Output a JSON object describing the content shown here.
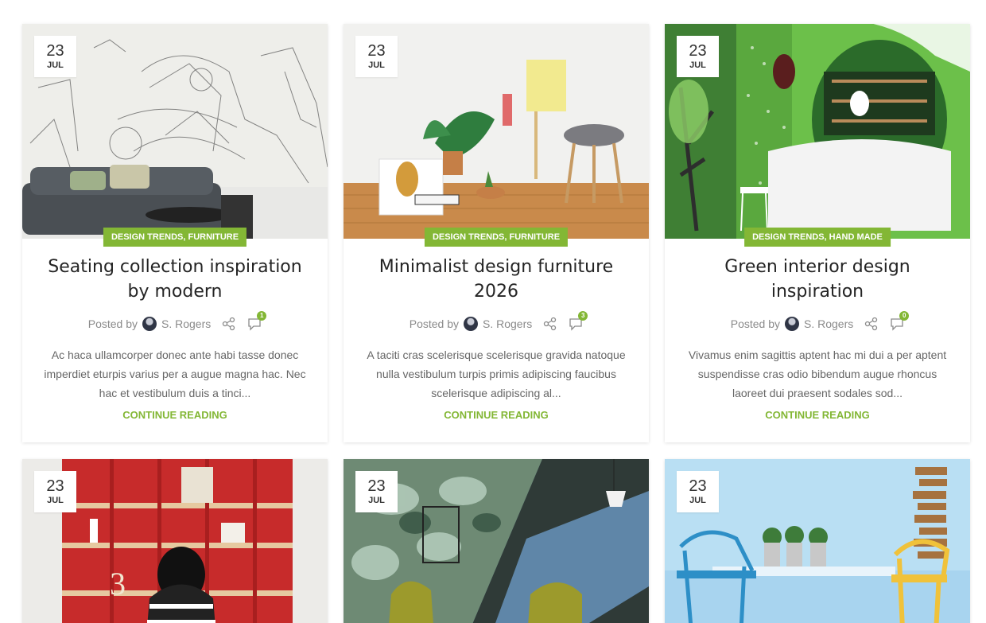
{
  "posts": [
    {
      "day": "23",
      "month": "JUL",
      "categories": "DESIGN TRENDS, FURNITURE",
      "title": "Seating collection inspiration by modern",
      "posted_by_label": "Posted by",
      "author": "S. Rogers",
      "comments": "1",
      "excerpt": "Ac haca ullamcorper donec ante habi tasse donec imperdiet eturpis varius per a augue magna hac. Nec hac et vestibulum duis a tinci...",
      "more": "CONTINUE READING"
    },
    {
      "day": "23",
      "month": "JUL",
      "categories": "DESIGN TRENDS, FURNITURE",
      "title": "Minimalist design furniture 2026",
      "posted_by_label": "Posted by",
      "author": "S. Rogers",
      "comments": "3",
      "excerpt": "A taciti cras scelerisque scelerisque gravida natoque nulla vestibulum turpis primis adipiscing faucibus scelerisque adipiscing al...",
      "more": "CONTINUE READING"
    },
    {
      "day": "23",
      "month": "JUL",
      "categories": "DESIGN TRENDS, HAND MADE",
      "title": "Green interior design inspiration",
      "posted_by_label": "Posted by",
      "author": "S. Rogers",
      "comments": "0",
      "excerpt": "Vivamus enim sagittis aptent hac mi dui a per aptent suspendisse cras odio bibendum augue rhoncus laoreet dui praesent sodales sod...",
      "more": "CONTINUE READING"
    },
    {
      "day": "23",
      "month": "JUL"
    },
    {
      "day": "23",
      "month": "JUL"
    },
    {
      "day": "23",
      "month": "JUL"
    }
  ],
  "colors": {
    "accent": "#83b735",
    "title": "#242424",
    "muted": "#8a8a8a"
  },
  "icons": {
    "share": "share-icon",
    "comment": "comment-icon",
    "avatar": "avatar"
  }
}
